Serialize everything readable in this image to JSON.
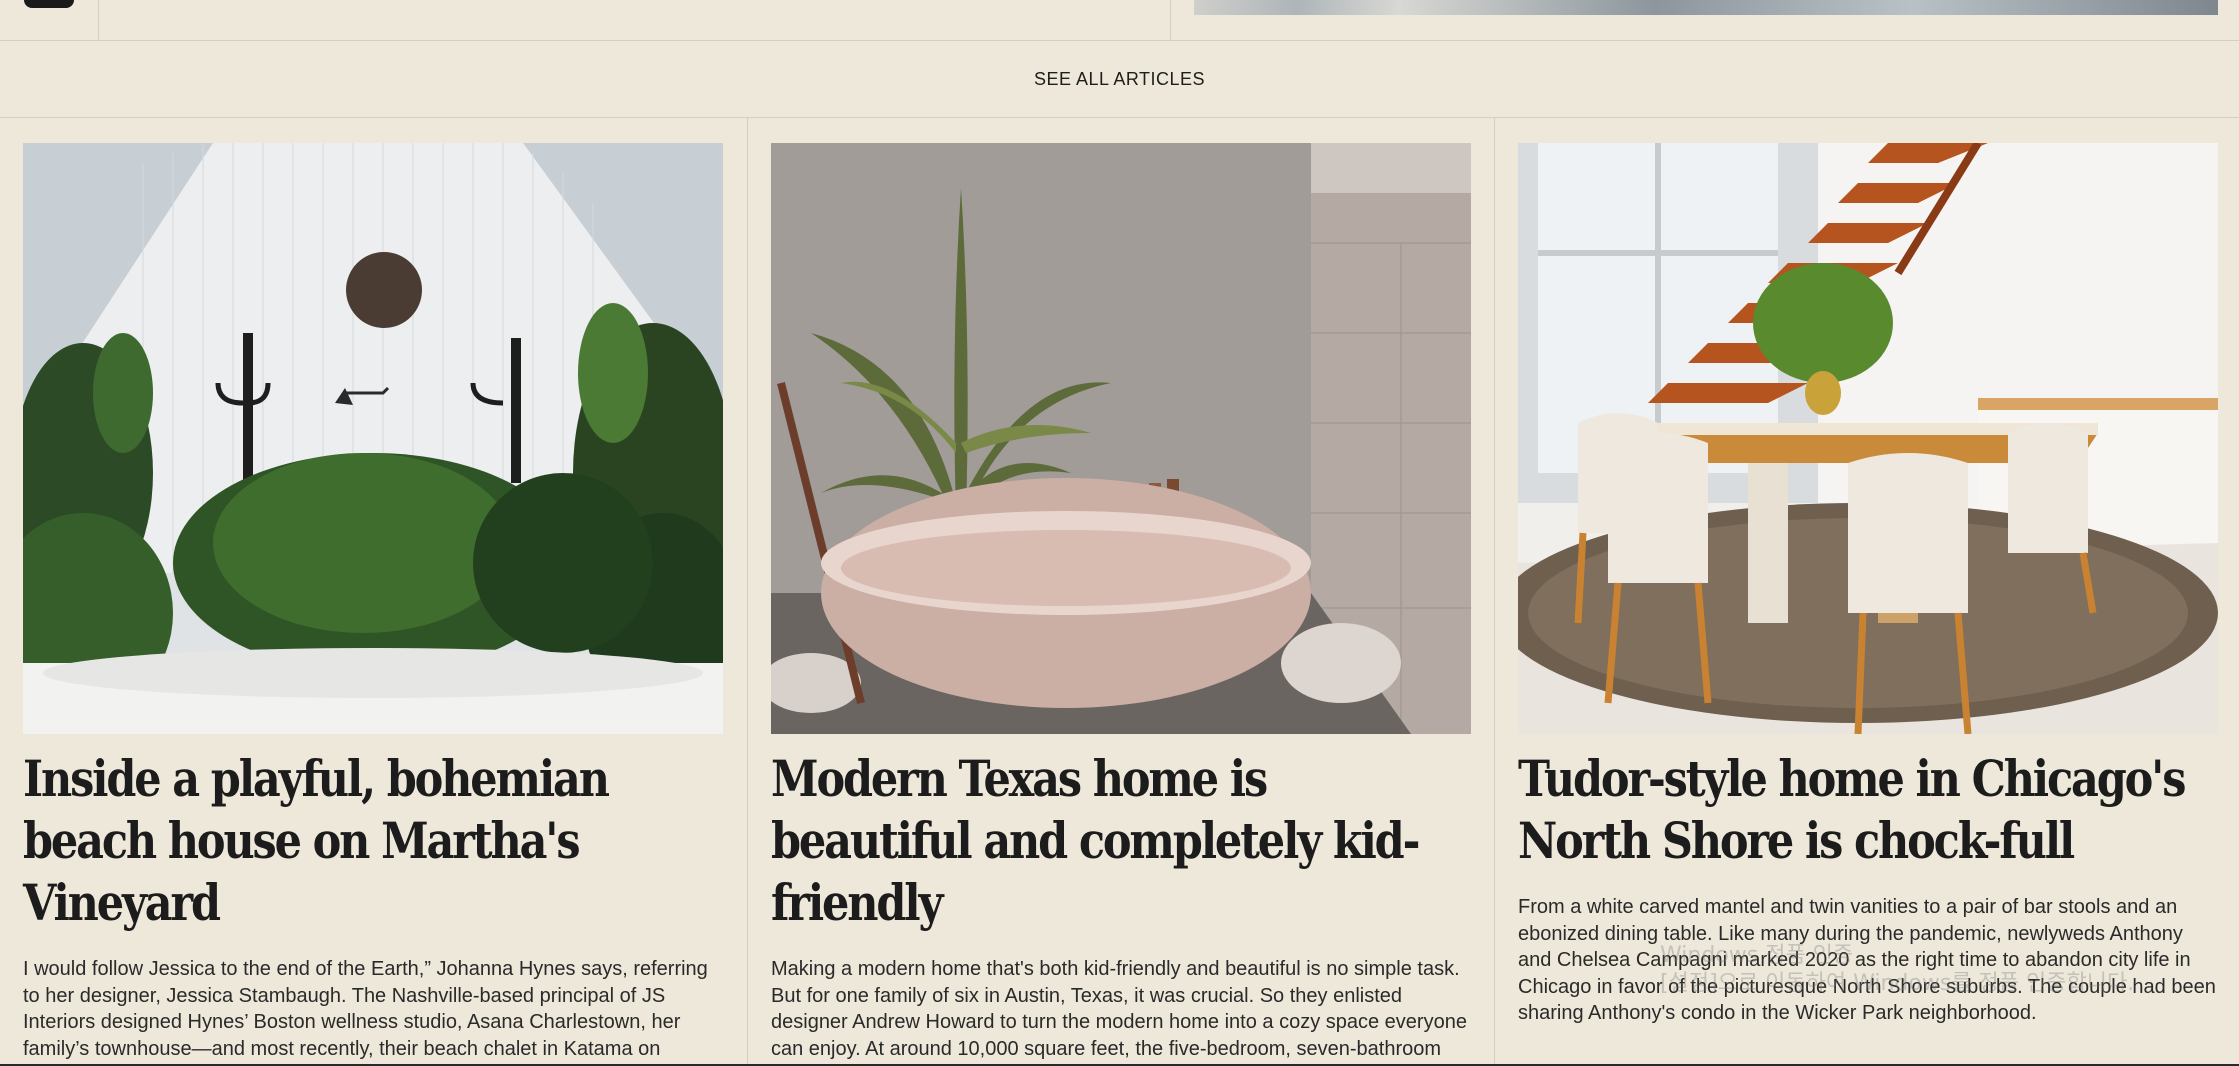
{
  "nav": {
    "see_all_label": "SEE ALL ARTICLES"
  },
  "articles": [
    {
      "title": "Inside a playful, bohemian beach house on Martha's Vineyard",
      "excerpt": "I would follow Jessica to the end of the Earth,” Johanna Hynes says, referring to her designer, Jessica Stambaugh. The Nashville-based principal of JS Interiors designed Hynes’ Boston wellness studio, Asana Charlestown, her family’s townhouse—and most recently, their beach chalet in Katama on Martha’s Vineyard."
    },
    {
      "title": "Modern Texas home is beautiful and completely kid-friendly",
      "excerpt": "Making a modern home that's both kid-friendly and beautiful is no simple task. But for one family of six in Austin, Texas, it was crucial. So they enlisted designer Andrew Howard to turn the modern home into a cozy space everyone can enjoy. At around 10,000 square feet, the five-bedroom, seven-bathroom home needed both cosmetic changes and structural tweaks."
    },
    {
      "title": "Tudor-style home in Chicago's North Shore is chock-full",
      "excerpt": "From a white carved mantel and twin vanities to a pair of bar stools and an ebonized dining table. Like many during the pandemic, newlyweds Anthony and Chelsea Campagni marked 2020 as the right time to abandon city life in Chicago in favor of the picturesque North Shore suburbs. The couple had been sharing Anthony's condo in the Wicker Park neighborhood."
    }
  ],
  "watermark": {
    "line1": "Windows 정품 인증",
    "line2": "[설정]으로 이동하여 Windows를 정품 인증합니다."
  }
}
